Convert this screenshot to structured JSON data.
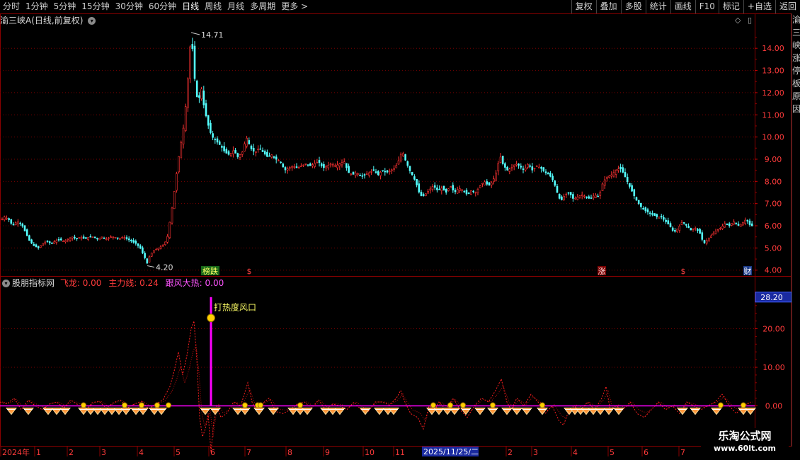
{
  "toolbar": {
    "periods": [
      "分时",
      "1分钟",
      "5分钟",
      "15分钟",
      "30分钟",
      "60分钟",
      "日线",
      "周线",
      "月线",
      "多周期",
      "更多 >"
    ],
    "active_period": "日线",
    "actions": [
      "复权",
      "叠加",
      "多股",
      "统计",
      "画线",
      "F10",
      "标记",
      "+自选",
      "返回"
    ]
  },
  "stock": {
    "name": "渝三峡A",
    "mode": "(日线,前复权)"
  },
  "indicator": {
    "name": "股朋指标网",
    "line1_label": "飞龙: 0.00",
    "line2_label": "主力线: 0.24",
    "line3_label": "跟风大热: 0.00",
    "annotation": "打热度风口",
    "current_value": "28.20"
  },
  "price_annotations": {
    "high": "14.71",
    "low": "4.20"
  },
  "event_markers": [
    {
      "label": "榜跌",
      "kind": "board"
    },
    {
      "label": "$",
      "kind": "dollar"
    },
    {
      "label": "涨",
      "kind": "rise"
    },
    {
      "label": "$",
      "kind": "dollar"
    },
    {
      "label": "财",
      "kind": "finance"
    }
  ],
  "time_axis": {
    "labels": [
      "2024年",
      "1",
      "2",
      "3",
      "4",
      "5",
      "6",
      "7",
      "8",
      "9",
      "10",
      "11",
      "2",
      "3",
      "4",
      "5",
      "6",
      "7"
    ],
    "cursor_date": "2025/11/25/二"
  },
  "side_strip_text": [
    "渝",
    "三",
    "峡",
    "涨",
    "停",
    "板",
    "原",
    "因"
  ],
  "watermark": {
    "site_name": "乐淘公式网",
    "site_url": "www.60lt.com"
  },
  "colors": {
    "up": "#ff3232",
    "down": "#54ffff",
    "grid": "#7a0000",
    "magenta": "#ff00ff",
    "yellow": "#ffff00"
  },
  "chart_data": [
    {
      "type": "candlestick",
      "title": "渝三峡A (日线,前复权)",
      "ylim": [
        3.8,
        14.9
      ],
      "y_ticks": [
        4.0,
        5.0,
        6.0,
        7.0,
        8.0,
        9.0,
        10.0,
        11.0,
        12.0,
        13.0,
        14.0
      ],
      "x_month_labels": [
        "2024年",
        "1",
        "2",
        "3",
        "4",
        "5",
        "6",
        "7",
        "8",
        "9",
        "10",
        "11",
        "2",
        "3",
        "4",
        "5",
        "6",
        "7"
      ],
      "max_annotation": 14.71,
      "min_annotation": 4.2,
      "close_path": [
        [
          0,
          6.2
        ],
        [
          6,
          6.4
        ],
        [
          12,
          6.3
        ],
        [
          18,
          6.0
        ],
        [
          24,
          6.2
        ],
        [
          30,
          6.1
        ],
        [
          36,
          5.7
        ],
        [
          42,
          5.3
        ],
        [
          48,
          5.1
        ],
        [
          54,
          5.0
        ],
        [
          60,
          5.2
        ],
        [
          66,
          5.3
        ],
        [
          72,
          5.2
        ],
        [
          78,
          5.3
        ],
        [
          84,
          5.4
        ],
        [
          90,
          5.3
        ],
        [
          96,
          5.4
        ],
        [
          102,
          5.5
        ],
        [
          108,
          5.4
        ],
        [
          114,
          5.5
        ],
        [
          120,
          5.4
        ],
        [
          126,
          5.5
        ],
        [
          132,
          5.5
        ],
        [
          138,
          5.4
        ],
        [
          144,
          5.5
        ],
        [
          150,
          5.4
        ],
        [
          156,
          5.5
        ],
        [
          162,
          5.5
        ],
        [
          168,
          5.4
        ],
        [
          174,
          5.5
        ],
        [
          180,
          5.4
        ],
        [
          186,
          5.3
        ],
        [
          192,
          5.2
        ],
        [
          198,
          5.0
        ],
        [
          204,
          4.6
        ],
        [
          208,
          4.3
        ],
        [
          212,
          4.7
        ],
        [
          218,
          4.9
        ],
        [
          224,
          5.0
        ],
        [
          230,
          5.1
        ],
        [
          236,
          5.4
        ],
        [
          240,
          6.2
        ],
        [
          244,
          7.0
        ],
        [
          248,
          8.0
        ],
        [
          252,
          9.0
        ],
        [
          256,
          9.8
        ],
        [
          260,
          10.6
        ],
        [
          264,
          12.0
        ],
        [
          268,
          13.8
        ],
        [
          270,
          14.7
        ],
        [
          273,
          13.5
        ],
        [
          276,
          12.2
        ],
        [
          280,
          11.5
        ],
        [
          284,
          12.3
        ],
        [
          288,
          11.4
        ],
        [
          292,
          10.8
        ],
        [
          296,
          10.3
        ],
        [
          300,
          10.0
        ],
        [
          306,
          9.8
        ],
        [
          312,
          9.6
        ],
        [
          318,
          9.3
        ],
        [
          324,
          9.2
        ],
        [
          330,
          9.4
        ],
        [
          336,
          9.1
        ],
        [
          342,
          9.3
        ],
        [
          348,
          10.0
        ],
        [
          354,
          9.5
        ],
        [
          360,
          9.3
        ],
        [
          366,
          9.5
        ],
        [
          372,
          9.3
        ],
        [
          378,
          9.1
        ],
        [
          384,
          9.2
        ],
        [
          390,
          9.0
        ],
        [
          396,
          8.9
        ],
        [
          402,
          8.5
        ],
        [
          408,
          8.6
        ],
        [
          414,
          8.7
        ],
        [
          420,
          8.6
        ],
        [
          426,
          8.7
        ],
        [
          432,
          8.8
        ],
        [
          438,
          8.7
        ],
        [
          444,
          8.8
        ],
        [
          450,
          8.9
        ],
        [
          456,
          8.6
        ],
        [
          462,
          8.7
        ],
        [
          468,
          8.8
        ],
        [
          474,
          8.7
        ],
        [
          480,
          8.8
        ],
        [
          486,
          8.9
        ],
        [
          492,
          8.4
        ],
        [
          498,
          8.3
        ],
        [
          504,
          8.4
        ],
        [
          510,
          8.2
        ],
        [
          516,
          8.3
        ],
        [
          522,
          8.4
        ],
        [
          528,
          8.5
        ],
        [
          534,
          8.3
        ],
        [
          540,
          8.5
        ],
        [
          546,
          8.4
        ],
        [
          552,
          8.5
        ],
        [
          558,
          8.6
        ],
        [
          564,
          9.0
        ],
        [
          568,
          9.4
        ],
        [
          572,
          9.0
        ],
        [
          576,
          8.7
        ],
        [
          580,
          8.4
        ],
        [
          584,
          8.2
        ],
        [
          588,
          7.9
        ],
        [
          592,
          7.5
        ],
        [
          596,
          7.3
        ],
        [
          600,
          7.4
        ],
        [
          606,
          7.6
        ],
        [
          612,
          7.8
        ],
        [
          618,
          7.6
        ],
        [
          624,
          7.7
        ],
        [
          630,
          7.5
        ],
        [
          636,
          7.8
        ],
        [
          642,
          7.5
        ],
        [
          648,
          7.7
        ],
        [
          654,
          7.6
        ],
        [
          660,
          7.4
        ],
        [
          666,
          7.6
        ],
        [
          672,
          7.5
        ],
        [
          678,
          7.8
        ],
        [
          684,
          8.0
        ],
        [
          690,
          7.8
        ],
        [
          696,
          8.0
        ],
        [
          702,
          8.5
        ],
        [
          706,
          9.2
        ],
        [
          710,
          8.8
        ],
        [
          716,
          8.5
        ],
        [
          722,
          8.6
        ],
        [
          728,
          8.8
        ],
        [
          734,
          8.7
        ],
        [
          740,
          8.5
        ],
        [
          746,
          8.8
        ],
        [
          752,
          8.5
        ],
        [
          758,
          8.7
        ],
        [
          764,
          8.6
        ],
        [
          770,
          8.4
        ],
        [
          776,
          8.3
        ],
        [
          782,
          8.0
        ],
        [
          788,
          7.4
        ],
        [
          792,
          7.1
        ],
        [
          798,
          7.4
        ],
        [
          804,
          7.5
        ],
        [
          810,
          7.2
        ],
        [
          816,
          7.3
        ],
        [
          822,
          7.4
        ],
        [
          828,
          7.3
        ],
        [
          834,
          7.2
        ],
        [
          840,
          7.4
        ],
        [
          846,
          7.3
        ],
        [
          852,
          8.0
        ],
        [
          858,
          8.2
        ],
        [
          864,
          8.3
        ],
        [
          870,
          8.5
        ],
        [
          876,
          8.6
        ],
        [
          880,
          8.4
        ],
        [
          886,
          8.0
        ],
        [
          892,
          7.6
        ],
        [
          898,
          7.2
        ],
        [
          904,
          6.9
        ],
        [
          910,
          6.7
        ],
        [
          916,
          6.6
        ],
        [
          922,
          6.5
        ],
        [
          928,
          6.4
        ],
        [
          934,
          6.4
        ],
        [
          940,
          6.2
        ],
        [
          946,
          6.0
        ],
        [
          952,
          5.7
        ],
        [
          958,
          5.9
        ],
        [
          964,
          6.2
        ],
        [
          970,
          6.0
        ],
        [
          976,
          5.8
        ],
        [
          982,
          5.9
        ],
        [
          988,
          5.7
        ],
        [
          994,
          5.2
        ],
        [
          1000,
          5.4
        ],
        [
          1006,
          5.6
        ],
        [
          1012,
          5.8
        ],
        [
          1018,
          5.9
        ],
        [
          1024,
          6.1
        ],
        [
          1030,
          6.0
        ],
        [
          1036,
          6.2
        ],
        [
          1042,
          6.0
        ],
        [
          1048,
          6.1
        ],
        [
          1054,
          6.3
        ],
        [
          1060,
          6.0
        ],
        [
          1064,
          6.0
        ]
      ]
    },
    {
      "type": "line",
      "title": "股朋指标网",
      "ylim": [
        -10,
        30
      ],
      "y_ticks": [
        0.0,
        10.0,
        20.0
      ],
      "series": [
        {
          "name": "飞龙",
          "color": "#ff2020",
          "style": "dashed"
        },
        {
          "name": "主力线",
          "color": "#ff2020",
          "style": "dashed"
        },
        {
          "name": "跟风大热",
          "color": "#ff00ff",
          "style": "solid"
        }
      ],
      "spike": {
        "x": 298,
        "value": 28.2,
        "label": "打热度风口"
      },
      "main_line": [
        [
          0,
          1
        ],
        [
          10,
          0.5
        ],
        [
          20,
          2
        ],
        [
          30,
          -1
        ],
        [
          40,
          1.5
        ],
        [
          50,
          0
        ],
        [
          60,
          -1
        ],
        [
          70,
          0.5
        ],
        [
          80,
          1
        ],
        [
          90,
          -0.5
        ],
        [
          100,
          1.5
        ],
        [
          110,
          0.3
        ],
        [
          120,
          -1.5
        ],
        [
          130,
          0.8
        ],
        [
          140,
          1.2
        ],
        [
          150,
          -0.6
        ],
        [
          160,
          0.8
        ],
        [
          170,
          1.5
        ],
        [
          180,
          -0.5
        ],
        [
          190,
          0.5
        ],
        [
          200,
          1.2
        ],
        [
          210,
          -0.8
        ],
        [
          220,
          0.5
        ],
        [
          230,
          1.5
        ],
        [
          240,
          5
        ],
        [
          246,
          9
        ],
        [
          252,
          14
        ],
        [
          258,
          8
        ],
        [
          264,
          13
        ],
        [
          270,
          20
        ],
        [
          274,
          22
        ],
        [
          278,
          12
        ],
        [
          282,
          -3
        ],
        [
          286,
          -8
        ],
        [
          290,
          -6
        ],
        [
          294,
          -2
        ],
        [
          298,
          -12
        ],
        [
          302,
          -4
        ],
        [
          306,
          0
        ],
        [
          312,
          -3
        ],
        [
          320,
          -2
        ],
        [
          330,
          1
        ],
        [
          340,
          0
        ],
        [
          350,
          6
        ],
        [
          356,
          1
        ],
        [
          362,
          -1
        ],
        [
          370,
          0.5
        ],
        [
          380,
          2
        ],
        [
          390,
          -1.5
        ],
        [
          400,
          -2
        ],
        [
          410,
          -1
        ],
        [
          420,
          0.5
        ],
        [
          430,
          1
        ],
        [
          440,
          -0.5
        ],
        [
          450,
          1.5
        ],
        [
          460,
          -1
        ],
        [
          470,
          0.5
        ],
        [
          480,
          0
        ],
        [
          490,
          -1
        ],
        [
          500,
          1
        ],
        [
          510,
          -1
        ],
        [
          520,
          -1.5
        ],
        [
          530,
          1
        ],
        [
          540,
          1
        ],
        [
          550,
          0.2
        ],
        [
          560,
          2
        ],
        [
          566,
          4
        ],
        [
          572,
          1
        ],
        [
          580,
          -2
        ],
        [
          590,
          -3
        ],
        [
          598,
          -6
        ],
        [
          606,
          0
        ],
        [
          614,
          -1
        ],
        [
          620,
          1
        ],
        [
          630,
          -1
        ],
        [
          640,
          2
        ],
        [
          650,
          -1
        ],
        [
          660,
          -3
        ],
        [
          670,
          0
        ],
        [
          680,
          2
        ],
        [
          690,
          1
        ],
        [
          700,
          4
        ],
        [
          708,
          7
        ],
        [
          716,
          1
        ],
        [
          722,
          -1
        ],
        [
          730,
          2
        ],
        [
          740,
          0
        ],
        [
          750,
          3
        ],
        [
          760,
          1
        ],
        [
          770,
          -2
        ],
        [
          780,
          0
        ],
        [
          790,
          -4
        ],
        [
          796,
          -5
        ],
        [
          802,
          -2
        ],
        [
          810,
          0
        ],
        [
          820,
          -1
        ],
        [
          830,
          1
        ],
        [
          840,
          -1
        ],
        [
          850,
          2
        ],
        [
          856,
          5
        ],
        [
          862,
          -1
        ],
        [
          870,
          0
        ],
        [
          880,
          -1
        ],
        [
          890,
          1
        ],
        [
          900,
          -2
        ],
        [
          910,
          -3
        ],
        [
          920,
          -1
        ],
        [
          930,
          1
        ],
        [
          940,
          -1
        ],
        [
          950,
          0
        ],
        [
          960,
          -2
        ],
        [
          970,
          1
        ],
        [
          980,
          0
        ],
        [
          990,
          -1
        ],
        [
          1000,
          0
        ],
        [
          1010,
          1
        ],
        [
          1020,
          3
        ],
        [
          1030,
          0
        ],
        [
          1040,
          -2
        ],
        [
          1050,
          0
        ],
        [
          1060,
          1
        ]
      ]
    }
  ]
}
